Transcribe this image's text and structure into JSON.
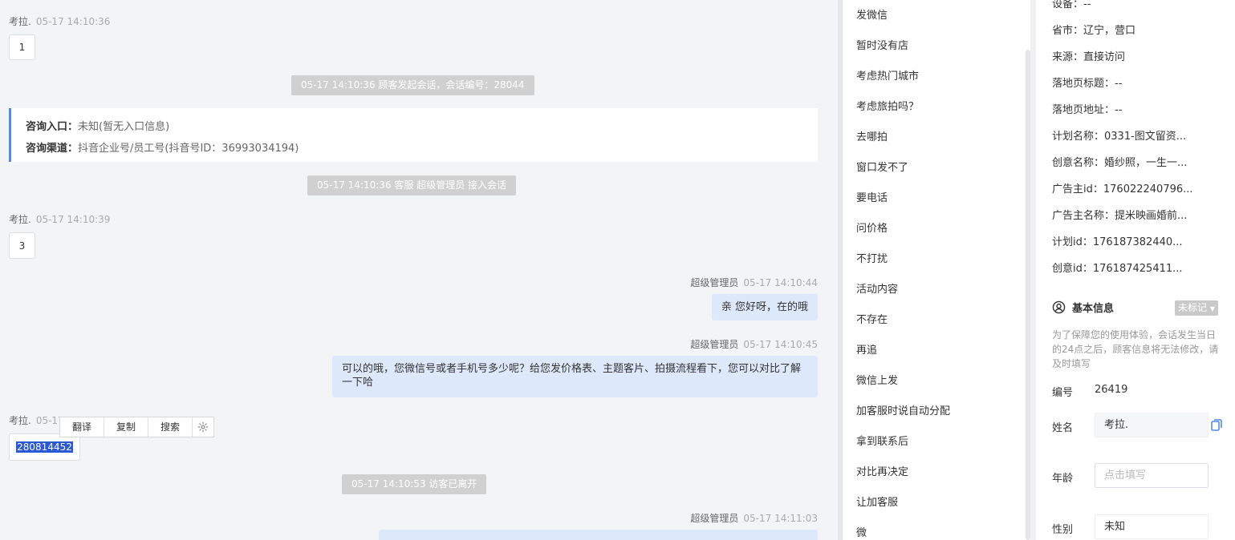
{
  "chat": {
    "messages": [
      {
        "sender": "考拉.",
        "time": "05-17 14:10:36",
        "text": "1"
      },
      {
        "system": "05-17 14:10:36 顾客发起会话，会话编号：28044"
      },
      {
        "entry_label": "咨询入口：",
        "entry_value": "未知(暂无入口信息)",
        "channel_label": "咨询渠道：",
        "channel_value": "抖音企业号/员工号(抖音号ID：36993034194)"
      },
      {
        "system": "05-17 14:10:36 客服 超级管理员 接入会话"
      },
      {
        "sender": "考拉.",
        "time": "05-17 14:10:39",
        "text": "3"
      },
      {
        "sender": "超级管理员",
        "time": "05-17 14:10:44",
        "text": "亲 您好呀，在的哦"
      },
      {
        "sender": "超级管理员",
        "time": "05-17 14:10:45",
        "text": "可以的哦，您微信号或者手机号多少呢？给您发价格表、主题客片、拍摄流程看下，您可以对比了解一下哈"
      },
      {
        "sender": "考拉.",
        "time_partial": "05-17",
        "text": "280814452"
      },
      {
        "system": "05-17 14:10:53 访客已离开"
      },
      {
        "sender": "超级管理员",
        "time": "05-17 14:11:03"
      }
    ],
    "context_menu": [
      "翻译",
      "复制",
      "搜索"
    ]
  },
  "quick_replies": [
    "发微信",
    "暂时没有店",
    "考虑热门城市",
    "考虑旅拍吗？",
    "去哪拍",
    "窗口发不了",
    "要电话",
    "问价格",
    "不打扰",
    "活动内容",
    "不存在",
    "再追",
    "微信上发",
    "加客服时说自动分配",
    "拿到联系后",
    "对比再决定",
    "让加客服",
    "微"
  ],
  "info": {
    "device_partial": "设备：--",
    "rows": [
      {
        "label": "省市：",
        "value": "辽宁，营口"
      },
      {
        "label": "来源：",
        "value": "直接访问"
      },
      {
        "label": "落地页标题：",
        "value": "--"
      },
      {
        "label": "落地页地址：",
        "value": "--"
      },
      {
        "label": "计划名称：",
        "value": "0331-图文留资..."
      },
      {
        "label": "创意名称：",
        "value": "婚纱照，一生一..."
      },
      {
        "label": "广告主id：",
        "value": "176022240796..."
      },
      {
        "label": "广告主名称：",
        "value": "提米映画婚前..."
      },
      {
        "label": "计划id：",
        "value": "176187382440..."
      },
      {
        "label": "创意id：",
        "value": "176187425411..."
      }
    ],
    "basic_title": "基本信息",
    "mark_badge": "未标记",
    "notice": "为了保障您的使用体验，会话发生当日的24点之后，顾客信息将无法修改，请及时填写",
    "id_label": "编号",
    "id_value": "26419",
    "name_label": "姓名",
    "name_value": "考拉.",
    "age_label": "年龄",
    "age_placeholder": "点击填写",
    "gender_label": "性别",
    "gender_value": "未知"
  },
  "colors": {
    "accent": "#4e8af2",
    "bubble_agent": "#dde9fb",
    "system_bg": "#d0d0d0",
    "selection": "#2a58d6"
  }
}
